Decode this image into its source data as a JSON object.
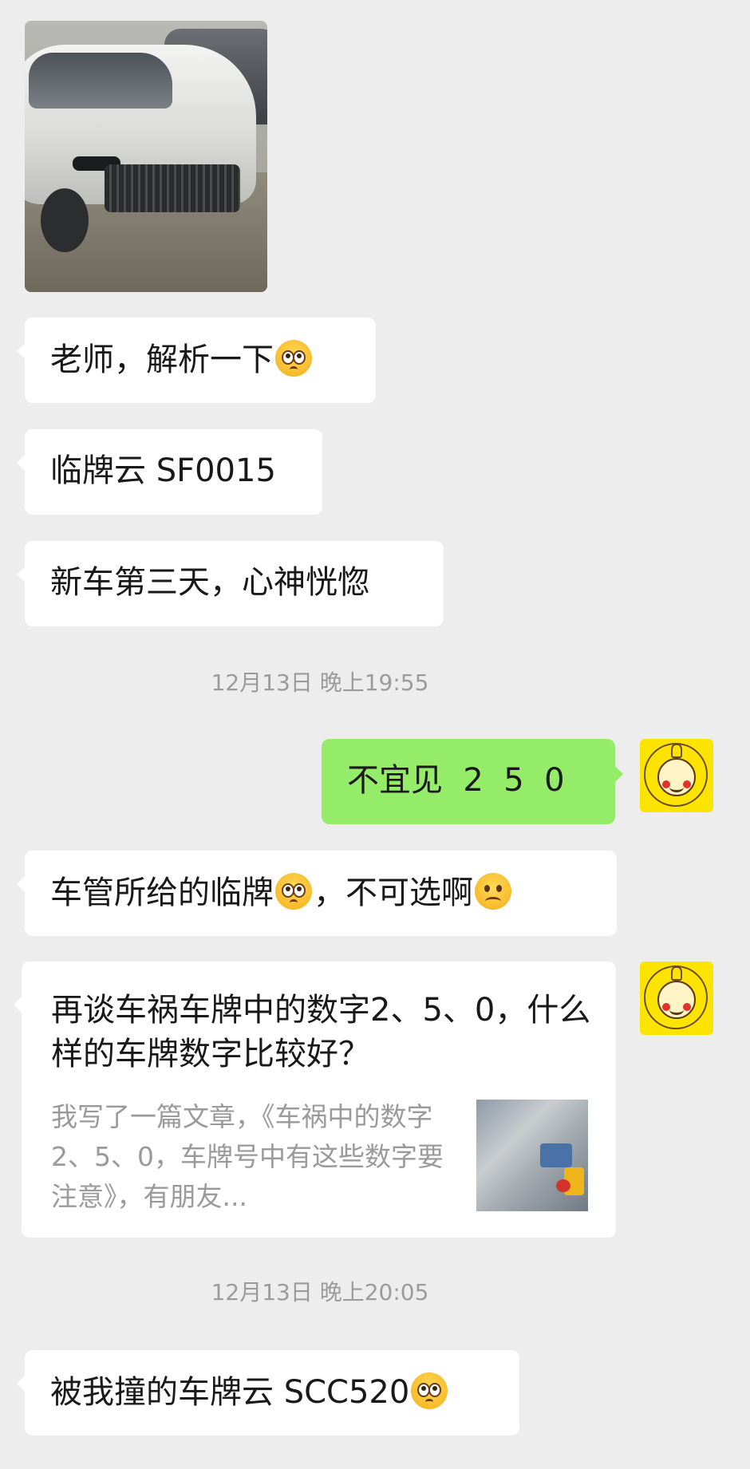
{
  "messages": {
    "m1": "老师，解析一下",
    "m2": "临牌云 SF0015",
    "m3": "新车第三天，心神恍惚",
    "t1": "12月13日 晚上19:55",
    "m4": "不宜见  2  5  0",
    "m5a": "车管所给的临牌",
    "m5b": "，不可选啊",
    "card": {
      "title": "再谈车祸车牌中的数字2、5、0，什么样的车牌数字比较好？",
      "desc": "我写了一篇文章，《车祸中的数字2、5、0，车牌号中有这些数字要注意》，有朋友..."
    },
    "t2": "12月13日 晚上20:05",
    "m6": "被我撞的车牌云 SCC520"
  },
  "colors": {
    "background": "#ededed",
    "incoming_bubble": "#ffffff",
    "outgoing_bubble": "#95ec69",
    "avatar_bg": "#fde400",
    "timestamp": "#9b9b9b"
  },
  "icons": {
    "rolling_eyes": "face-with-rolling-eyes-emoji",
    "frown": "slightly-frowning-face-emoji"
  }
}
